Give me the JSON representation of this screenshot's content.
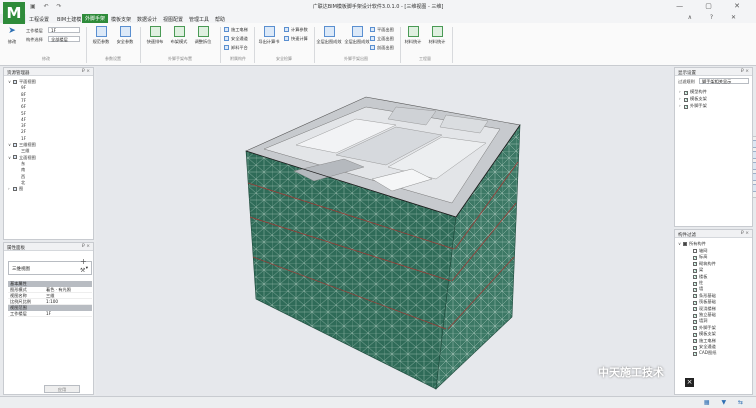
{
  "app": {
    "logo": "M",
    "title": "广联达BIM模板脚手架设计软件3.0.1.0 - [三维视图 - 三维]",
    "quick_access": "▣ ↶ ↷"
  },
  "menu_tabs": [
    "工程设置",
    "BIM土建模",
    "外脚手架",
    "模板支架",
    "数据设计",
    "视图配置",
    "管理工具",
    "帮助"
  ],
  "active_tab": "外脚手架",
  "ribbon": {
    "select_label": "修改",
    "floor_label": "工作楼层",
    "floor_value": "1F",
    "view_label": "构件选择",
    "view_value": "全部楼层",
    "buttons": [
      "规范参数",
      "安全参数",
      "快速排布",
      "布架模式",
      "调整拆位",
      "施工电梯",
      "导出计算书",
      "计算参数",
      "快速计算",
      "全层出图成效",
      "全层出图成效",
      "材料统计",
      "材料统计"
    ],
    "small_buttons": [
      "施工电梯",
      "安全通道",
      "卸料平台",
      "计算参数",
      "快速计算",
      "平面出图",
      "立面出图",
      "剖面出图"
    ],
    "groups": [
      "修改",
      "参数设置",
      "外脚手架布置",
      "附属构件",
      "安全检算",
      "外脚手架出图",
      "工程量"
    ]
  },
  "project_browser": {
    "title": "资源管理器",
    "pin": "₽ × ",
    "items": [
      {
        "exp": "∨",
        "label": "平面视图",
        "level": 0,
        "box": true
      },
      {
        "exp": "",
        "label": "9F",
        "level": 1
      },
      {
        "exp": "",
        "label": "8F",
        "level": 1
      },
      {
        "exp": "",
        "label": "7F",
        "level": 1
      },
      {
        "exp": "",
        "label": "6F",
        "level": 1
      },
      {
        "exp": "",
        "label": "5F",
        "level": 1
      },
      {
        "exp": "",
        "label": "4F",
        "level": 1
      },
      {
        "exp": "",
        "label": "3F",
        "level": 1
      },
      {
        "exp": "",
        "label": "2F",
        "level": 1
      },
      {
        "exp": "",
        "label": "1F",
        "level": 1
      },
      {
        "exp": "∨",
        "label": "三维视图",
        "level": 0,
        "box": true
      },
      {
        "exp": "",
        "label": "三维",
        "level": 1
      },
      {
        "exp": "∨",
        "label": "立面视图",
        "level": 0,
        "box": true
      },
      {
        "exp": "",
        "label": "东",
        "level": 1
      },
      {
        "exp": "",
        "label": "南",
        "level": 1
      },
      {
        "exp": "",
        "label": "西",
        "level": 1
      },
      {
        "exp": "",
        "label": "北",
        "level": 1
      },
      {
        "exp": "›",
        "label": "图",
        "level": 0,
        "box": true
      }
    ]
  },
  "properties": {
    "title": "属性面板",
    "pin": "₽ × ",
    "type_selector": "三维视图",
    "section1": "基本属性",
    "rows1": [
      {
        "key": "图形模式",
        "val": "着色 · 有光照"
      },
      {
        "key": "视图名称",
        "val": "三维"
      },
      {
        "key": "比例尺比例",
        "val": "1:100"
      }
    ],
    "section2": "视图范围",
    "rows2": [
      {
        "key": "工作楼层",
        "val": "1F"
      }
    ],
    "apply": "应用"
  },
  "display_panel": {
    "title": "显示设置",
    "pin": "₽ × ",
    "selector_label": "过滤规则",
    "selector_value": "脚手架相关显示",
    "items": [
      {
        "exp": "›",
        "label": "模型构件",
        "checked": true
      },
      {
        "exp": "›",
        "label": "模板支架",
        "checked": true
      },
      {
        "exp": "›",
        "label": "外脚手架",
        "checked": true
      }
    ]
  },
  "filter_panel": {
    "title": "构件过滤",
    "pin": "₽ × ",
    "root": "所有构件",
    "items": [
      {
        "label": "轴网",
        "checked": false
      },
      {
        "label": "标高",
        "checked": true
      },
      {
        "label": "砌筑构件",
        "checked": true
      },
      {
        "label": "梁",
        "checked": true
      },
      {
        "label": "楼板",
        "checked": true
      },
      {
        "label": "柱",
        "checked": true
      },
      {
        "label": "墙",
        "checked": true
      },
      {
        "label": "条形基础",
        "checked": true
      },
      {
        "label": "筏板基础",
        "checked": true
      },
      {
        "label": "现浇楼梯",
        "checked": true
      },
      {
        "label": "独立基础",
        "checked": true
      },
      {
        "label": "墙洞",
        "checked": true
      },
      {
        "label": "外脚手架",
        "checked": true
      },
      {
        "label": "模板支架",
        "checked": true
      },
      {
        "label": "施工电梯",
        "checked": true
      },
      {
        "label": "安全通道",
        "checked": true
      },
      {
        "label": "CAD图纸",
        "checked": true
      }
    ]
  },
  "viewport": {
    "tools": [
      "rotate-icon",
      "zoom-icon",
      "pan-icon",
      "fit-icon",
      "home-icon"
    ]
  },
  "watermark": {
    "text": "中天施工技术",
    "close": "×"
  },
  "statusbar": {
    "icons": "▦ ▼ ⇆"
  },
  "window": {
    "controls": "— ▢ ✕",
    "help": "∧ ? ✕"
  }
}
